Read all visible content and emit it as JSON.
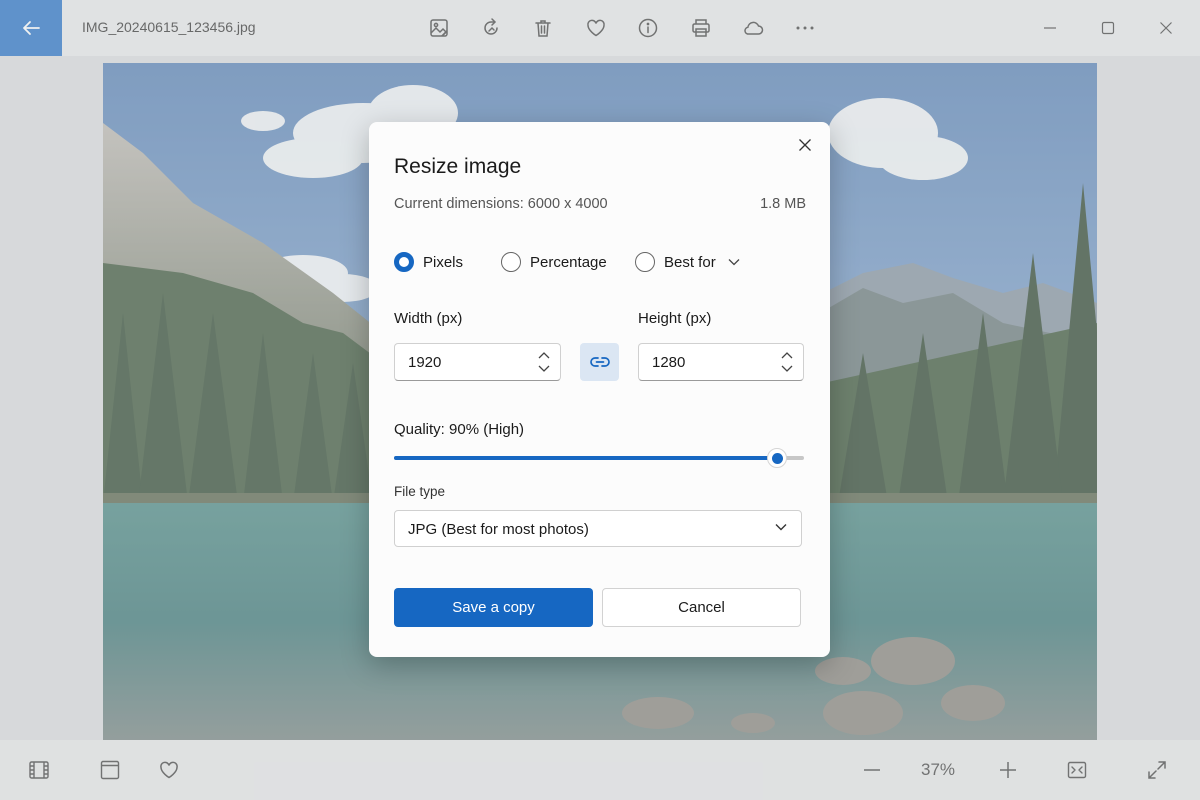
{
  "window": {
    "filename": "IMG_20240615_123456.jpg",
    "accent_color": "#1667c2"
  },
  "toolbar": {
    "icons": [
      "edit-image-icon",
      "rotate-icon",
      "delete-icon",
      "favorite-icon",
      "info-icon",
      "print-icon",
      "cloud-icon",
      "more-icon"
    ]
  },
  "window_controls": [
    "minimize-icon",
    "maximize-icon",
    "close-icon"
  ],
  "dialog": {
    "title": "Resize image",
    "current_dimensions_label": "Current dimensions: 6000 x 4000",
    "file_size": "1.8 MB",
    "modes": [
      {
        "label": "Pixels",
        "selected": true
      },
      {
        "label": "Percentage",
        "selected": false
      },
      {
        "label": "Best for",
        "selected": false
      }
    ],
    "width": {
      "label": "Width (px)",
      "value": "1920"
    },
    "height": {
      "label": "Height (px)",
      "value": "1280"
    },
    "aspect_lock": {
      "icon": "link-icon",
      "locked": true
    },
    "quality": {
      "label": "Quality: 90% (High)",
      "value_percent": 90
    },
    "file_type": {
      "label": "File type",
      "value": "JPG (Best for most photos)"
    },
    "primary_button": "Save a copy",
    "secondary_button": "Cancel"
  },
  "bottombar": {
    "zoom": "37%"
  }
}
